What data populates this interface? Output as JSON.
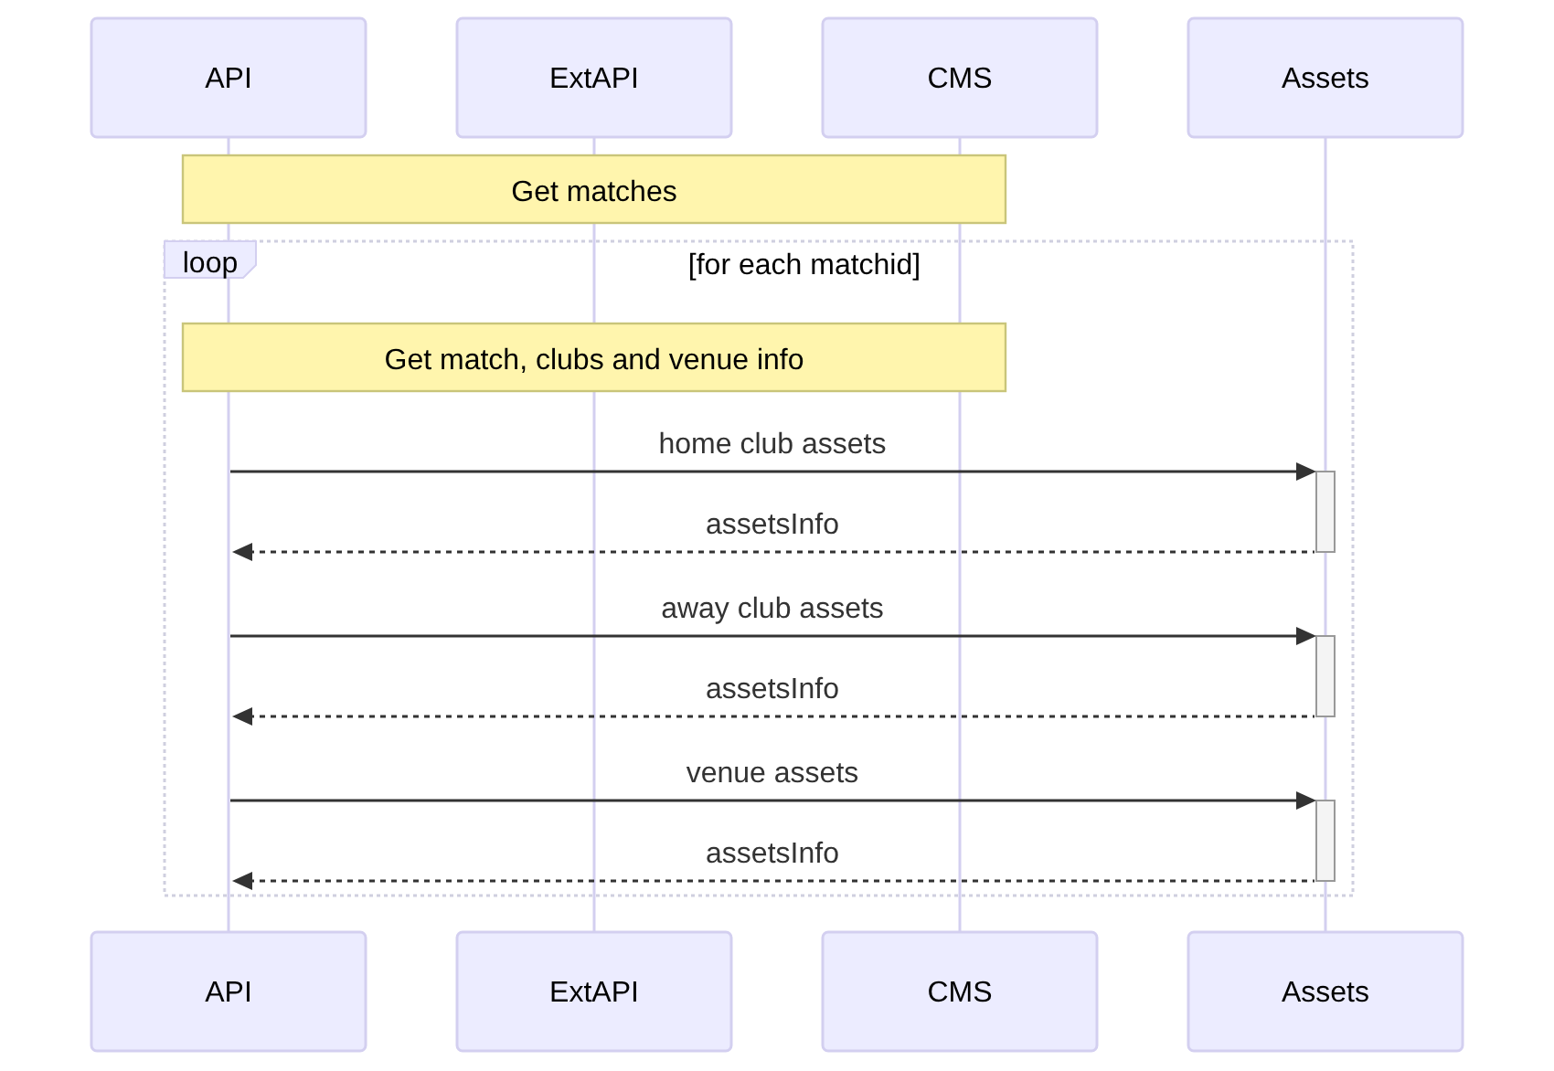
{
  "participants_top": [
    {
      "name": "API"
    },
    {
      "name": "ExtAPI"
    },
    {
      "name": "CMS"
    },
    {
      "name": "Assets"
    }
  ],
  "note": {
    "text": "Get matches"
  },
  "loop": {
    "label": "loop",
    "condition": "[for each matchid]",
    "note": {
      "text": "Get match, clubs and venue info"
    },
    "messages": [
      {
        "kind": "call",
        "text": "home club assets"
      },
      {
        "kind": "reply",
        "text": "assetsInfo"
      },
      {
        "kind": "call",
        "text": "away club assets"
      },
      {
        "kind": "reply",
        "text": "assetsInfo"
      },
      {
        "kind": "call",
        "text": "venue assets"
      },
      {
        "kind": "reply",
        "text": "assetsInfo"
      }
    ]
  },
  "participants_bottom": [
    {
      "name": "API"
    },
    {
      "name": "ExtAPI"
    },
    {
      "name": "CMS"
    },
    {
      "name": "Assets"
    }
  ]
}
